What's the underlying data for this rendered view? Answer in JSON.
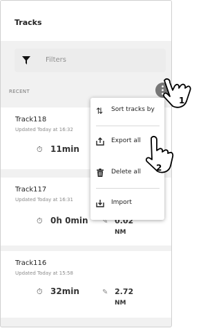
{
  "header": {
    "title": "Tracks"
  },
  "filter": {
    "placeholder": "Filters",
    "icon": "filter-icon"
  },
  "section": {
    "label": "RECENT"
  },
  "tracks": [
    {
      "name": "Track118",
      "updated": "Updated Today at 16:32",
      "duration": "11min",
      "distance": "",
      "unit": ""
    },
    {
      "name": "Track117",
      "updated": "Updated Today at 16:31",
      "duration": "0h 0min",
      "distance": "0.02",
      "unit": "NM"
    },
    {
      "name": "Track116",
      "updated": "Updated Today at 15:58",
      "duration": "32min",
      "distance": "2.72",
      "unit": "NM"
    }
  ],
  "menu": {
    "items": [
      {
        "label": "Sort tracks by",
        "icon": "sort-icon"
      },
      {
        "label": "Export all",
        "icon": "export-icon"
      },
      {
        "label": "Delete all",
        "icon": "trash-icon"
      },
      {
        "label": "Import",
        "icon": "import-icon"
      }
    ]
  },
  "callouts": {
    "first": "1",
    "second": "2"
  }
}
